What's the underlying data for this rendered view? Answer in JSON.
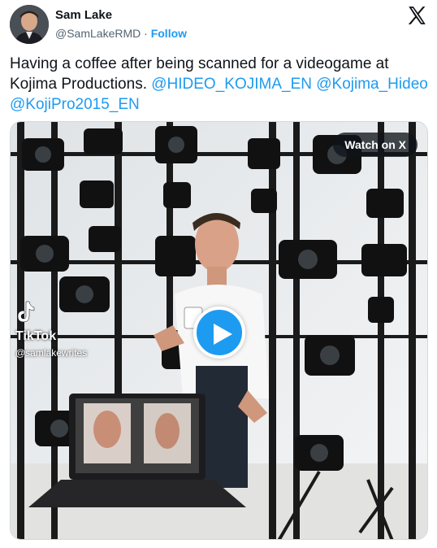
{
  "author": {
    "name": "Sam Lake",
    "handle": "@SamLakeRMD",
    "separator": " · ",
    "follow_label": "Follow"
  },
  "tweet": {
    "text": "Having a coffee after being scanned for a videogame at Kojima Productions.",
    "mentions": [
      "@HIDEO_KOJIMA_EN",
      "@Kojima_Hideo",
      "@KojiPro2015_EN"
    ]
  },
  "media": {
    "watch_label": "Watch on X",
    "watermark_brand": "TikTok",
    "watermark_user": "@samlakewrites"
  },
  "icons": {
    "platform_logo": "x-logo-icon",
    "play": "play-icon",
    "watermark": "tiktok-icon"
  },
  "colors": {
    "accent": "#1d9bf0",
    "text": "#0f1419",
    "muted": "#536471"
  }
}
